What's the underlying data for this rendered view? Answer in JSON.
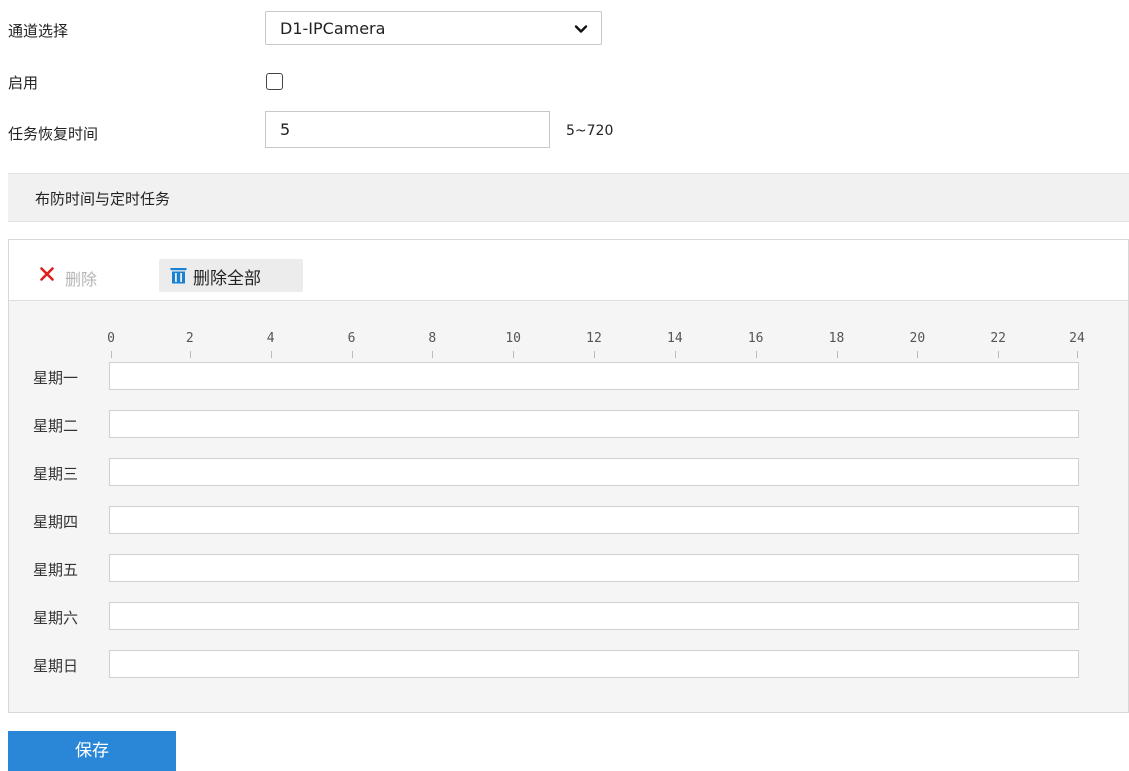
{
  "form": {
    "channel_label": "通道选择",
    "channel_value": "D1-IPCamera",
    "enable_label": "启用",
    "enable_checked": false,
    "recovery_label": "任务恢复时间",
    "recovery_value": "5",
    "recovery_range": "5~720"
  },
  "section": {
    "title": "布防时间与定时任务"
  },
  "toolbar": {
    "delete_label": "删除",
    "delete_all_label": "删除全部"
  },
  "schedule": {
    "hours": [
      "0",
      "2",
      "4",
      "6",
      "8",
      "10",
      "12",
      "14",
      "16",
      "18",
      "20",
      "22",
      "24"
    ],
    "days": [
      "星期一",
      "星期二",
      "星期三",
      "星期四",
      "星期五",
      "星期六",
      "星期日"
    ]
  },
  "save_label": "保存",
  "colors": {
    "primary": "#2a87d8",
    "delete_icon": "#e02020",
    "delete_all_icon": "#1a82d2"
  },
  "icons": {
    "dropdown": "chevron-down-icon",
    "delete": "close-icon",
    "delete_all": "trash-icon"
  }
}
